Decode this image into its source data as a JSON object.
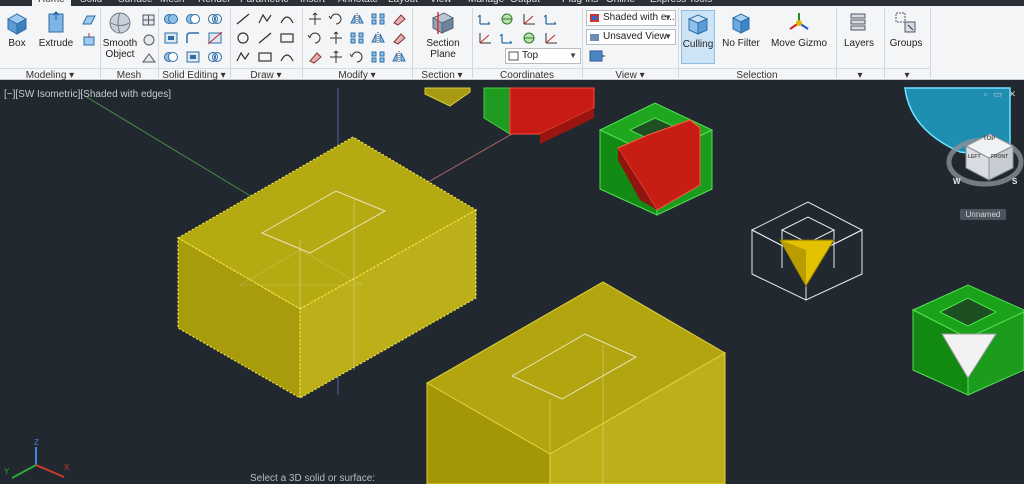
{
  "ribbon_tabs": [
    "Home",
    "Solid",
    "Surface",
    "Mesh",
    "Render",
    "Parametric",
    "Insert",
    "Annotate",
    "Layout",
    "View",
    "Manage",
    "Output",
    "Plug-ins",
    "Online",
    "Express Tools"
  ],
  "modeling": {
    "box_label": "Box",
    "extrude_label": "Extrude",
    "panel_label": "Modeling ▾"
  },
  "mesh": {
    "smooth_label_1": "Smooth",
    "smooth_label_2": "Object",
    "panel_label": "Mesh"
  },
  "solid_editing": {
    "panel_label": "Solid Editing ▾"
  },
  "draw": {
    "panel_label": "Draw ▾"
  },
  "modify": {
    "panel_label": "Modify ▾"
  },
  "section": {
    "plane_label_1": "Section",
    "plane_label_2": "Plane",
    "panel_label": "Section ▾"
  },
  "coordinates": {
    "ucs_view": "Top",
    "panel_label": "Coordinates"
  },
  "view": {
    "visual_style": "Shaded with e...",
    "saved_view": "Unsaved View",
    "panel_label": "View ▾"
  },
  "selection": {
    "culling_label": "Culling",
    "filter_label": "No Filter",
    "gizmo_label": "Move Gizmo",
    "panel_label": "Selection"
  },
  "layers": {
    "label": "Layers"
  },
  "groups": {
    "label": "Groups"
  },
  "viewport": {
    "label": "[−][SW Isometric][Shaded with edges]",
    "controls": "▫ ▭ ✕",
    "viewcube_label": "Unnamed",
    "viewcube_top": "TOP",
    "viewcube_left": "LEFT",
    "viewcube_front": "FRONT",
    "compass_w": "W",
    "compass_s": "S",
    "command_prompt": "Select a 3D solid or surface:"
  },
  "colors": {
    "ribbon_bg": "#f4f5f6",
    "viewport_bg": "#212830",
    "yellow_top": "#b7aa10",
    "green": "#1fa31f",
    "red": "#d6221a",
    "accent": "#2e7fcf"
  }
}
